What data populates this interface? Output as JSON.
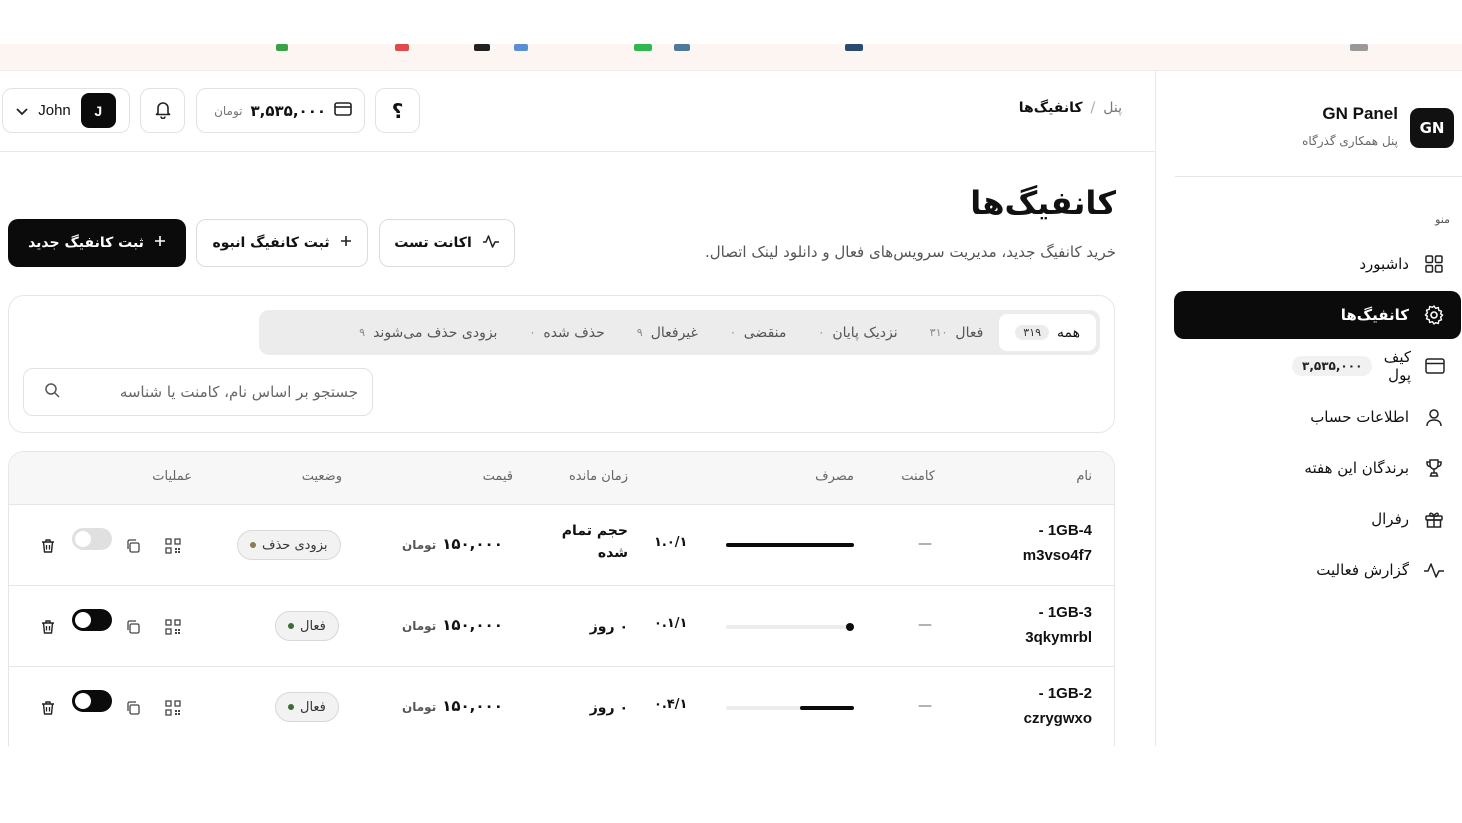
{
  "sidebar": {
    "logo_text": "GN",
    "brand_title": "GN Panel",
    "brand_subtitle": "پنل همکاری گذرگاه",
    "menu_caption": "منو",
    "items": [
      {
        "label": "داشبورد",
        "icon": "grid-icon"
      },
      {
        "label": "کانفیگ‌ها",
        "icon": "gear-icon",
        "active": true
      },
      {
        "label": "کیف پول",
        "icon": "wallet-icon",
        "badge": "۳,۵۳۵,۰۰۰"
      },
      {
        "label": "اطلاعات حساب",
        "icon": "user-icon"
      },
      {
        "label": "برندگان این هفته",
        "icon": "trophy-icon"
      },
      {
        "label": "رفرال",
        "icon": "gift-icon"
      },
      {
        "label": "گزارش فعالیت",
        "icon": "activity-icon"
      }
    ]
  },
  "header": {
    "breadcrumb_root": "پنل",
    "breadcrumb_sep": "/",
    "breadcrumb_current": "کانفیگ‌ها",
    "help_label": "؟",
    "wallet_amount": "۳,۵۳۵,۰۰۰",
    "wallet_currency": "تومان",
    "user_initial": "J",
    "user_name": "John"
  },
  "page": {
    "title": "کانفیگ‌ها",
    "subtitle": "خرید کانفیگ جدید، مدیریت سرویس‌های فعال و دانلود لینک اتصال.",
    "btn_new": "ثبت کانفیگ جدید",
    "btn_bulk": "ثبت کانفیگ انبوه",
    "btn_test": "اکانت تست"
  },
  "tabs": [
    {
      "label": "همه",
      "count": "۳۱۹",
      "active": true
    },
    {
      "label": "فعال",
      "count": "۳۱۰"
    },
    {
      "label": "نزدیک پایان",
      "count": "۰"
    },
    {
      "label": "منقضی",
      "count": "۰"
    },
    {
      "label": "غیرفعال",
      "count": "۹"
    },
    {
      "label": "حذف شده",
      "count": "۰"
    },
    {
      "label": "بزودی حذف می‌شوند",
      "count": "۹"
    }
  ],
  "search": {
    "placeholder": "جستجو بر اساس نام، کامنت یا شناسه"
  },
  "table": {
    "columns": {
      "name": "نام",
      "comment": "کامنت",
      "usage": "مصرف",
      "remaining": "زمان مانده",
      "price": "قیمت",
      "status": "وضعیت",
      "actions": "عملیات"
    },
    "rows": [
      {
        "name_line1": "1GB-4 -",
        "name_line2": "m3vso4f7",
        "comment": "—",
        "usage_text": "۱.۰/۱",
        "usage_fraction": 1.0,
        "remaining": "حجم تمام شده",
        "price": "۱۵۰,۰۰۰",
        "currency": "تومان",
        "status": "بزودی حذف",
        "status_color": "#8a7a55",
        "enabled": false
      },
      {
        "name_line1": "1GB-3 -",
        "name_line2": "3qkymrbl",
        "comment": "—",
        "usage_text": "۰.۱/۱",
        "usage_fraction": 0.03,
        "remaining": "۰ روز",
        "price": "۱۵۰,۰۰۰",
        "currency": "تومان",
        "status": "فعال",
        "status_color": "#3f6b35",
        "enabled": true
      },
      {
        "name_line1": "1GB-2 -",
        "name_line2": "czrygwxo",
        "comment": "—",
        "usage_text": "۰.۴/۱",
        "usage_fraction": 0.42,
        "remaining": "۰ روز",
        "price": "۱۵۰,۰۰۰",
        "currency": "تومان",
        "status": "فعال",
        "status_color": "#3f6b35",
        "enabled": true
      }
    ]
  }
}
